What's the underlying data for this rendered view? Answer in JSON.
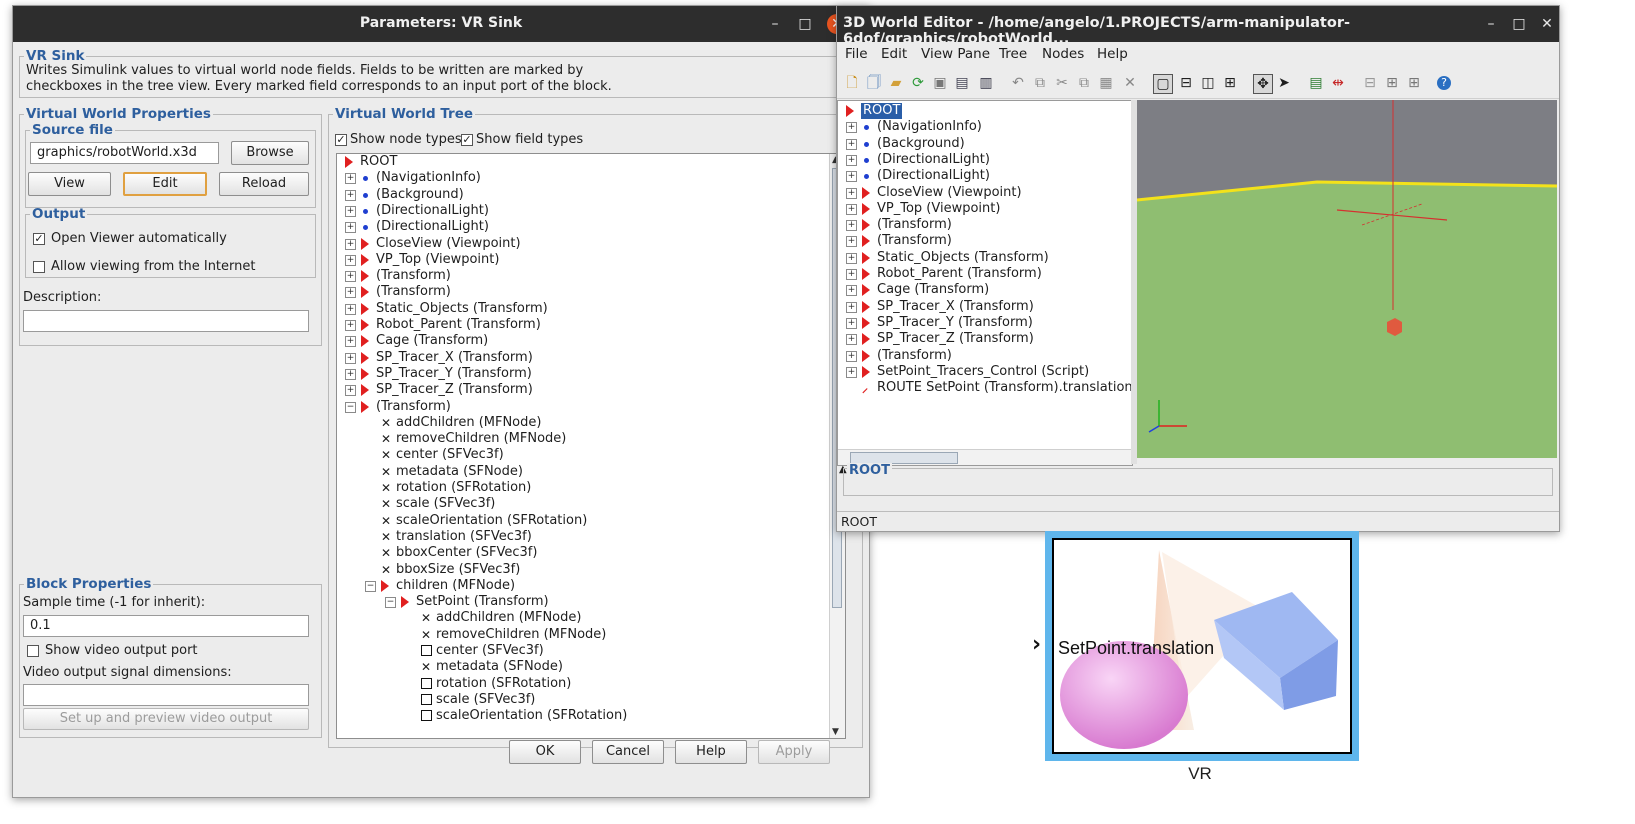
{
  "dialog": {
    "title": "Parameters: VR Sink",
    "window_buttons": {
      "minimize": "–",
      "maximize": "□",
      "close": "✕"
    },
    "vr_sink": {
      "legend": "VR Sink",
      "description_lines": [
        "Writes Simulink values to virtual world node fields. Fields to be written are marked by",
        "checkboxes in the tree view. Every marked field corresponds to an input port of the block."
      ]
    },
    "vwp": {
      "legend": "Virtual World Properties",
      "source_legend": "Source file",
      "source_value": "graphics/robotWorld.x3d",
      "browse": "Browse",
      "view": "View",
      "edit": "Edit",
      "reload": "Reload",
      "output_legend": "Output",
      "open_viewer": "Open Viewer automatically",
      "open_viewer_checked": true,
      "allow_internet": "Allow viewing from the Internet",
      "allow_internet_checked": false,
      "description_label": "Description:",
      "description_value": ""
    },
    "block": {
      "legend": "Block Properties",
      "sample_label": "Sample time (-1 for inherit):",
      "sample_value": "0.1",
      "video_port": "Show video output port",
      "video_port_checked": false,
      "video_dims_label": "Video output signal dimensions:",
      "video_dims_value": "",
      "setup_button": "Set up and preview video output"
    },
    "tree": {
      "legend": "Virtual World Tree",
      "show_node_types": "Show node types",
      "show_field_types": "Show field types",
      "rows": [
        {
          "indent": 0,
          "kind": "tri",
          "exp": "",
          "label": "ROOT"
        },
        {
          "indent": 1,
          "kind": "dot",
          "exp": "+",
          "label": "(NavigationInfo)"
        },
        {
          "indent": 1,
          "kind": "dot",
          "exp": "+",
          "label": "(Background)"
        },
        {
          "indent": 1,
          "kind": "dot",
          "exp": "+",
          "label": "(DirectionalLight)"
        },
        {
          "indent": 1,
          "kind": "dot",
          "exp": "+",
          "label": "(DirectionalLight)"
        },
        {
          "indent": 1,
          "kind": "tri",
          "exp": "+",
          "label": "CloseView (Viewpoint)"
        },
        {
          "indent": 1,
          "kind": "tri",
          "exp": "+",
          "label": "VP_Top (Viewpoint)"
        },
        {
          "indent": 1,
          "kind": "tri",
          "exp": "+",
          "label": " (Transform)"
        },
        {
          "indent": 1,
          "kind": "tri",
          "exp": "+",
          "label": " (Transform)"
        },
        {
          "indent": 1,
          "kind": "tri",
          "exp": "+",
          "label": "Static_Objects (Transform)"
        },
        {
          "indent": 1,
          "kind": "tri",
          "exp": "+",
          "label": "Robot_Parent (Transform)"
        },
        {
          "indent": 1,
          "kind": "tri",
          "exp": "+",
          "label": "Cage (Transform)"
        },
        {
          "indent": 1,
          "kind": "tri",
          "exp": "+",
          "label": "SP_Tracer_X (Transform)"
        },
        {
          "indent": 1,
          "kind": "tri",
          "exp": "+",
          "label": "SP_Tracer_Y (Transform)"
        },
        {
          "indent": 1,
          "kind": "tri",
          "exp": "+",
          "label": "SP_Tracer_Z (Transform)"
        },
        {
          "indent": 1,
          "kind": "tri",
          "exp": "−",
          "label": " (Transform)"
        },
        {
          "indent": 2,
          "kind": "x",
          "exp": "",
          "label": "addChildren (MFNode)"
        },
        {
          "indent": 2,
          "kind": "x",
          "exp": "",
          "label": "removeChildren (MFNode)"
        },
        {
          "indent": 2,
          "kind": "x",
          "exp": "",
          "label": "center (SFVec3f)"
        },
        {
          "indent": 2,
          "kind": "x",
          "exp": "",
          "label": "metadata (SFNode)"
        },
        {
          "indent": 2,
          "kind": "x",
          "exp": "",
          "label": "rotation (SFRotation)"
        },
        {
          "indent": 2,
          "kind": "x",
          "exp": "",
          "label": "scale (SFVec3f)"
        },
        {
          "indent": 2,
          "kind": "x",
          "exp": "",
          "label": "scaleOrientation (SFRotation)"
        },
        {
          "indent": 2,
          "kind": "x",
          "exp": "",
          "label": "translation (SFVec3f)"
        },
        {
          "indent": 2,
          "kind": "x",
          "exp": "",
          "label": "bboxCenter (SFVec3f)"
        },
        {
          "indent": 2,
          "kind": "x",
          "exp": "",
          "label": "bboxSize (SFVec3f)"
        },
        {
          "indent": 2,
          "kind": "tri",
          "exp": "−",
          "label": "children (MFNode)"
        },
        {
          "indent": 3,
          "kind": "tri",
          "exp": "−",
          "label": "SetPoint (Transform)"
        },
        {
          "indent": 4,
          "kind": "x",
          "exp": "",
          "label": "addChildren (MFNode)"
        },
        {
          "indent": 4,
          "kind": "x",
          "exp": "",
          "label": "removeChildren (MFNode)"
        },
        {
          "indent": 4,
          "kind": "box",
          "exp": "",
          "label": "center (SFVec3f)"
        },
        {
          "indent": 4,
          "kind": "x",
          "exp": "",
          "label": "metadata (SFNode)"
        },
        {
          "indent": 4,
          "kind": "box",
          "exp": "",
          "label": "rotation (SFRotation)"
        },
        {
          "indent": 4,
          "kind": "box",
          "exp": "",
          "label": "scale (SFVec3f)"
        },
        {
          "indent": 4,
          "kind": "box",
          "exp": "",
          "label": "scaleOrientation (SFRotation)"
        }
      ]
    },
    "buttons": {
      "ok": "OK",
      "cancel": "Cancel",
      "help": "Help",
      "apply": "Apply"
    }
  },
  "editor": {
    "title": "3D World Editor - /home/angelo/1.PROJECTS/arm-manipulator-6dof/graphics/robotWorld...",
    "menu": [
      "File",
      "Edit",
      "View Pane",
      "Tree",
      "Nodes",
      "Help"
    ],
    "tree_rows": [
      {
        "kind": "tri",
        "exp": "",
        "label": "ROOT",
        "selected": true
      },
      {
        "kind": "dot",
        "exp": "+",
        "label": "(NavigationInfo)"
      },
      {
        "kind": "dot",
        "exp": "+",
        "label": "(Background)"
      },
      {
        "kind": "dot",
        "exp": "+",
        "label": "(DirectionalLight)"
      },
      {
        "kind": "dot",
        "exp": "+",
        "label": "(DirectionalLight)"
      },
      {
        "kind": "tri",
        "exp": "+",
        "label": "CloseView (Viewpoint)"
      },
      {
        "kind": "tri",
        "exp": "+",
        "label": "VP_Top (Viewpoint)"
      },
      {
        "kind": "tri",
        "exp": "+",
        "label": " (Transform)"
      },
      {
        "kind": "tri",
        "exp": "+",
        "label": " (Transform)"
      },
      {
        "kind": "tri",
        "exp": "+",
        "label": "Static_Objects (Transform)"
      },
      {
        "kind": "tri",
        "exp": "+",
        "label": "Robot_Parent (Transform)"
      },
      {
        "kind": "tri",
        "exp": "+",
        "label": "Cage (Transform)"
      },
      {
        "kind": "tri",
        "exp": "+",
        "label": "SP_Tracer_X (Transform)"
      },
      {
        "kind": "tri",
        "exp": "+",
        "label": "SP_Tracer_Y (Transform)"
      },
      {
        "kind": "tri",
        "exp": "+",
        "label": "SP_Tracer_Z (Transform)"
      },
      {
        "kind": "tri",
        "exp": "+",
        "label": " (Transform)"
      },
      {
        "kind": "tri",
        "exp": "+",
        "label": "SetPoint_Tracers_Control (Script)"
      },
      {
        "kind": "route",
        "exp": "",
        "label": "ROUTE SetPoint (Transform).translation (S"
      }
    ],
    "field_legend": "ROOT",
    "status": "ROOT"
  },
  "vr_block": {
    "port_label": "SetPoint.translation",
    "caption": "VR"
  }
}
